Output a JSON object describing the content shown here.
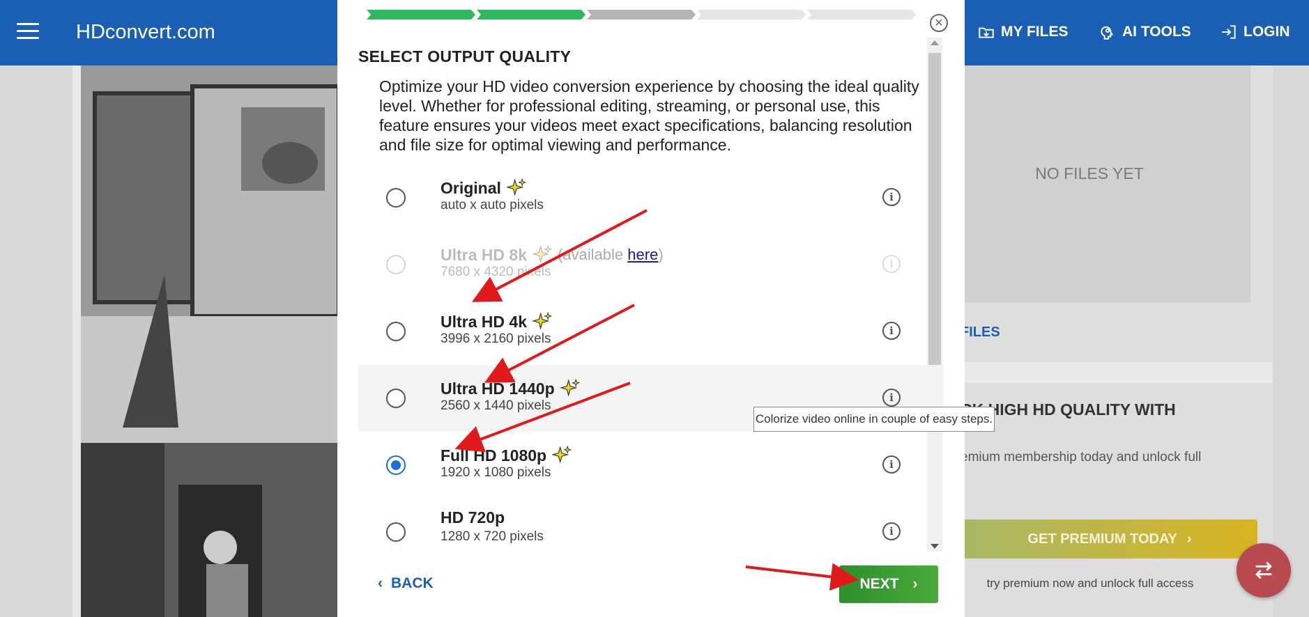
{
  "header": {
    "brand": "HDconvert.com",
    "nav": [
      {
        "label": "MY FILES",
        "icon": "download-folder-icon"
      },
      {
        "label": "AI TOOLS",
        "icon": "brain-icon"
      },
      {
        "label": "LOGIN",
        "icon": "login-icon"
      }
    ]
  },
  "background": {
    "no_files": "NO FILES YET",
    "files_link": "FILES",
    "unlock_title": "...CK HIGH HD QUALITY WITH ...",
    "unlock_title_line1": "CK HIGH HD QUALITY WITH",
    "unlock_desc": "emium membership today and unlock full",
    "premium_button": "GET PREMIUM TODAY",
    "try_text": "try premium now and unlock full access"
  },
  "modal": {
    "title": "SELECT OUTPUT QUALITY",
    "description": "Optimize your HD video conversion experience by choosing the ideal quality level. Whether for professional editing, streaming, or personal use, this feature ensures your videos meet exact specifications, balancing resolution and file size for optimal viewing and performance.",
    "progress_steps": [
      {
        "state": "done"
      },
      {
        "state": "done"
      },
      {
        "state": "current"
      },
      {
        "state": "todo"
      },
      {
        "state": "todo"
      }
    ],
    "options": [
      {
        "name": "Original",
        "sub": "auto x auto pixels",
        "selected": false,
        "disabled": false
      },
      {
        "name": "Ultra HD 8k",
        "sub": "7680 x 4320 pixels",
        "selected": false,
        "disabled": true,
        "available_prefix": "(available ",
        "available_link": "here",
        "available_suffix": ")"
      },
      {
        "name": "Ultra HD 4k",
        "sub": "3996 x 2160 pixels",
        "selected": false,
        "disabled": false
      },
      {
        "name": "Ultra HD 1440p",
        "sub": "2560 x 1440 pixels",
        "selected": false,
        "disabled": false
      },
      {
        "name": "Full HD 1080p",
        "sub": "1920 x 1080 pixels",
        "selected": true,
        "disabled": false
      },
      {
        "name": "HD 720p",
        "sub": "1280 x 720 pixels",
        "selected": false,
        "disabled": false
      }
    ],
    "back_label": "BACK",
    "next_label": "NEXT"
  },
  "tooltip": "Colorize video online in couple of easy steps.",
  "colors": {
    "brand_blue": "#1a5fb4",
    "progress_done": "#2eb862",
    "progress_current": "#b5b5b5",
    "progress_todo": "#e6e6e6",
    "radio_selected": "#1a6fd0",
    "next_green": "#3a9a34",
    "annotation_red": "#e01a1a"
  }
}
